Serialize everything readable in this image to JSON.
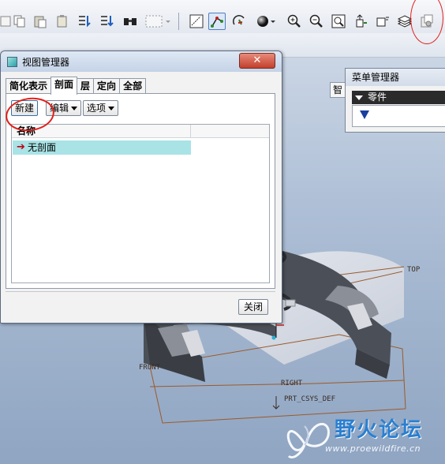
{
  "toolbar": {
    "icons": [
      "copy-icon",
      "paste-icon",
      "paste-special-icon",
      "regenerate-icon",
      "regenerate-manager-icon",
      "find-icon",
      "select-box-icon",
      "select-dropdown-icon",
      "named-view-icon",
      "datum-plane-display-icon",
      "spin-center-icon",
      "shading-icon",
      "zoom-in-icon",
      "zoom-out-icon",
      "refit-icon",
      "orient-icon",
      "saved-views-icon",
      "layers-icon",
      "view-manager-icon"
    ]
  },
  "view_manager": {
    "title": "视图管理器",
    "close_glyph": "✕",
    "tabs": [
      "简化表示",
      "剖面",
      "层",
      "定向",
      "全部"
    ],
    "active_tab": "剖面",
    "buttons": {
      "new": "新建",
      "edit": "编辑",
      "options": "选项"
    },
    "list": {
      "header": "名称",
      "rows": [
        "无剖面"
      ]
    },
    "close_button": "关闭"
  },
  "menu_manager": {
    "title": "菜单管理器",
    "item": "零件"
  },
  "side_button": "智",
  "model_labels": {
    "top": "TOP",
    "front": "FRONT",
    "right": "RIGHT",
    "csys": "PRT_CSYS_DEF"
  },
  "watermark": {
    "title": "野火论坛",
    "url": "www.proewildfire.cn"
  },
  "colors": {
    "highlight_row": "#a9e3e6",
    "annotation_red": "#e0201a",
    "part_dark": "#4a4f56"
  }
}
